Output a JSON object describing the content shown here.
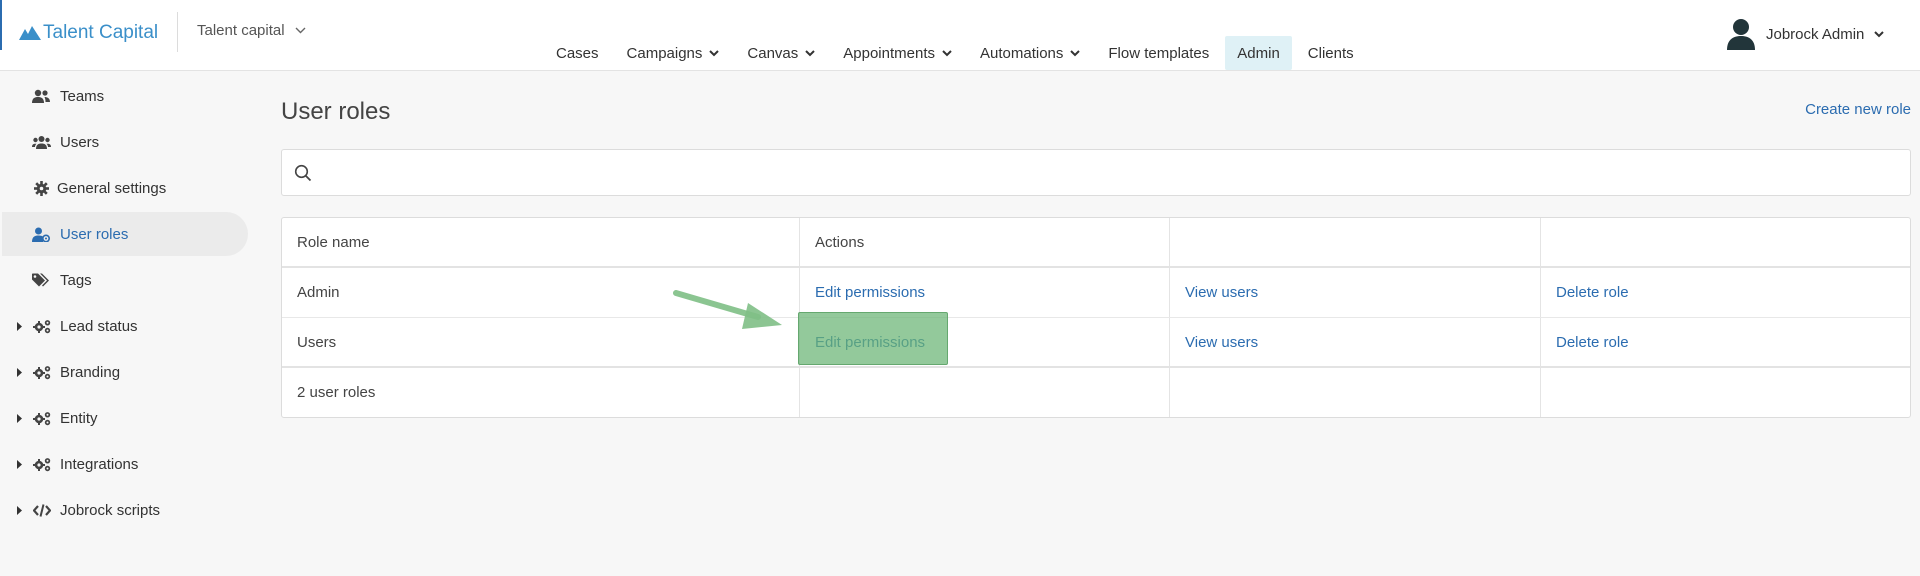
{
  "header": {
    "logo_text": "Talent Capital",
    "org_select": "Talent capital",
    "nav": [
      {
        "label": "Cases",
        "dropdown": false,
        "active": false
      },
      {
        "label": "Campaigns",
        "dropdown": true,
        "active": false
      },
      {
        "label": "Canvas",
        "dropdown": true,
        "active": false
      },
      {
        "label": "Appointments",
        "dropdown": true,
        "active": false
      },
      {
        "label": "Automations",
        "dropdown": true,
        "active": false
      },
      {
        "label": "Flow templates",
        "dropdown": false,
        "active": false
      },
      {
        "label": "Admin",
        "dropdown": false,
        "active": true
      },
      {
        "label": "Clients",
        "dropdown": false,
        "active": false
      }
    ],
    "user_name": "Jobrock Admin"
  },
  "sidebar": {
    "items": [
      {
        "label": "Teams",
        "icon": "teams-icon",
        "expandable": false,
        "active": false
      },
      {
        "label": "Users",
        "icon": "users-icon",
        "expandable": false,
        "active": false
      },
      {
        "label": "General settings",
        "icon": "gear-icon",
        "expandable": false,
        "active": false
      },
      {
        "label": "User roles",
        "icon": "user-roles-icon",
        "expandable": false,
        "active": true
      },
      {
        "label": "Tags",
        "icon": "tags-icon",
        "expandable": false,
        "active": false
      },
      {
        "label": "Lead status",
        "icon": "cogs-icon",
        "expandable": true,
        "active": false
      },
      {
        "label": "Branding",
        "icon": "cogs-icon",
        "expandable": true,
        "active": false
      },
      {
        "label": "Entity",
        "icon": "cogs-icon",
        "expandable": true,
        "active": false
      },
      {
        "label": "Integrations",
        "icon": "cogs-icon",
        "expandable": true,
        "active": false
      },
      {
        "label": "Jobrock scripts",
        "icon": "code-icon",
        "expandable": true,
        "active": false
      }
    ]
  },
  "main": {
    "title": "User roles",
    "create_link": "Create new role",
    "search_placeholder": "",
    "table": {
      "headers": [
        "Role name",
        "Actions",
        "",
        ""
      ],
      "rows": [
        {
          "role": "Admin",
          "edit": "Edit permissions",
          "view": "View users",
          "delete": "Delete role"
        },
        {
          "role": "Users",
          "edit": "Edit permissions",
          "view": "View users",
          "delete": "Delete role"
        }
      ],
      "footer": "2 user roles"
    }
  },
  "colors": {
    "accent": "#2b6cb0",
    "logo": "#3a8fc9",
    "active_nav_bg": "#dff1f6",
    "highlight": "#6ab474"
  }
}
